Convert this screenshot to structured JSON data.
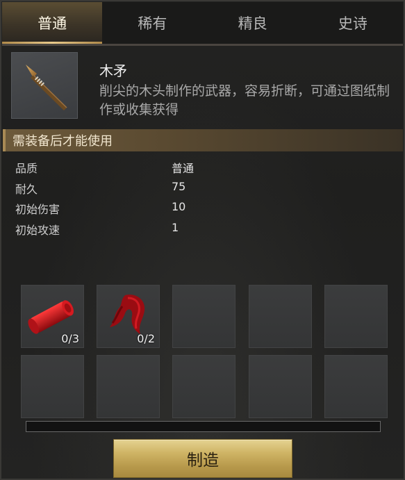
{
  "tabs": [
    {
      "label": "普通",
      "active": true
    },
    {
      "label": "稀有",
      "active": false
    },
    {
      "label": "精良",
      "active": false
    },
    {
      "label": "史诗",
      "active": false
    }
  ],
  "item": {
    "icon": "wooden-spear-icon",
    "name": "木矛",
    "description": "削尖的木头制作的武器，容易折断，可通过图纸制作或收集获得"
  },
  "requirement_text": "需装备后才能使用",
  "stats": [
    {
      "label": "品质",
      "value": "普通"
    },
    {
      "label": "耐久",
      "value": "75"
    },
    {
      "label": "初始伤害",
      "value": "10"
    },
    {
      "label": "初始攻速",
      "value": "1"
    }
  ],
  "materials": [
    {
      "icon": "red-wood-log-icon",
      "count": "0/3"
    },
    {
      "icon": "red-cloth-icon",
      "count": "0/2"
    },
    {
      "icon": "",
      "count": ""
    },
    {
      "icon": "",
      "count": ""
    },
    {
      "icon": "",
      "count": ""
    },
    {
      "icon": "",
      "count": ""
    },
    {
      "icon": "",
      "count": ""
    },
    {
      "icon": "",
      "count": ""
    },
    {
      "icon": "",
      "count": ""
    },
    {
      "icon": "",
      "count": ""
    }
  ],
  "progress": 0,
  "craft_button_label": "制造",
  "colors": {
    "accent_gold": "#cfb465",
    "active_tab": "#5a4d33",
    "material_red": "#c0141a"
  }
}
